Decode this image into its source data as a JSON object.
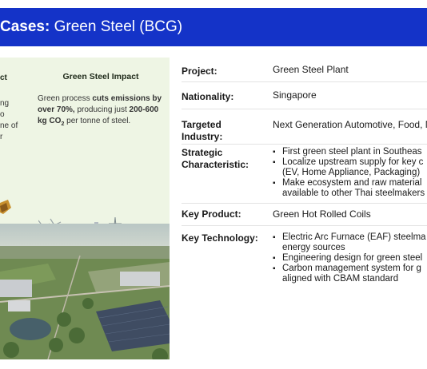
{
  "header": {
    "title_bold": "Cases:",
    "title_rest": "Green Steel (BCG)"
  },
  "left_card": {
    "partial_heading": "ct",
    "partial_lines": [
      "ng",
      "o",
      "ne of",
      "r"
    ],
    "impact_title": "Green Steel Impact",
    "impact_text_1": "Green process ",
    "impact_bold_1": "cuts emissions by over 70%,",
    "impact_text_2": " producing just ",
    "impact_bold_2": "200-600 kg CO",
    "impact_sub": "2",
    "impact_text_3": " per tonne of steel."
  },
  "details": {
    "project_label": "Project:",
    "project_value": "Green Steel Plant",
    "nationality_label": "Nationality:",
    "nationality_value": "Singapore",
    "industry_label_1": "Targeted",
    "industry_label_2": "Industry:",
    "industry_value": "Next Generation Automotive, Food, M",
    "strategic_label_1": "Strategic",
    "strategic_label_2": "Characteristic:",
    "strategic_items": [
      "First green steel plant in Southeas",
      "Localize upstream supply for key c",
      "(EV, Home Appliance, Packaging)",
      "Make ecosystem and raw material",
      "available to other Thai steelmakers"
    ],
    "product_label": "Key Product:",
    "product_value": "Green Hot Rolled Coils",
    "technology_label": "Key Technology:",
    "technology_items": [
      "Electric Arc Furnace (EAF) steelma",
      "energy sources",
      "Engineering design for green steel",
      "Carbon management system for g",
      "aligned with CBAM standard"
    ]
  },
  "colors": {
    "header_bg": "#1433c8",
    "panel_bg": "#eef5e4"
  }
}
